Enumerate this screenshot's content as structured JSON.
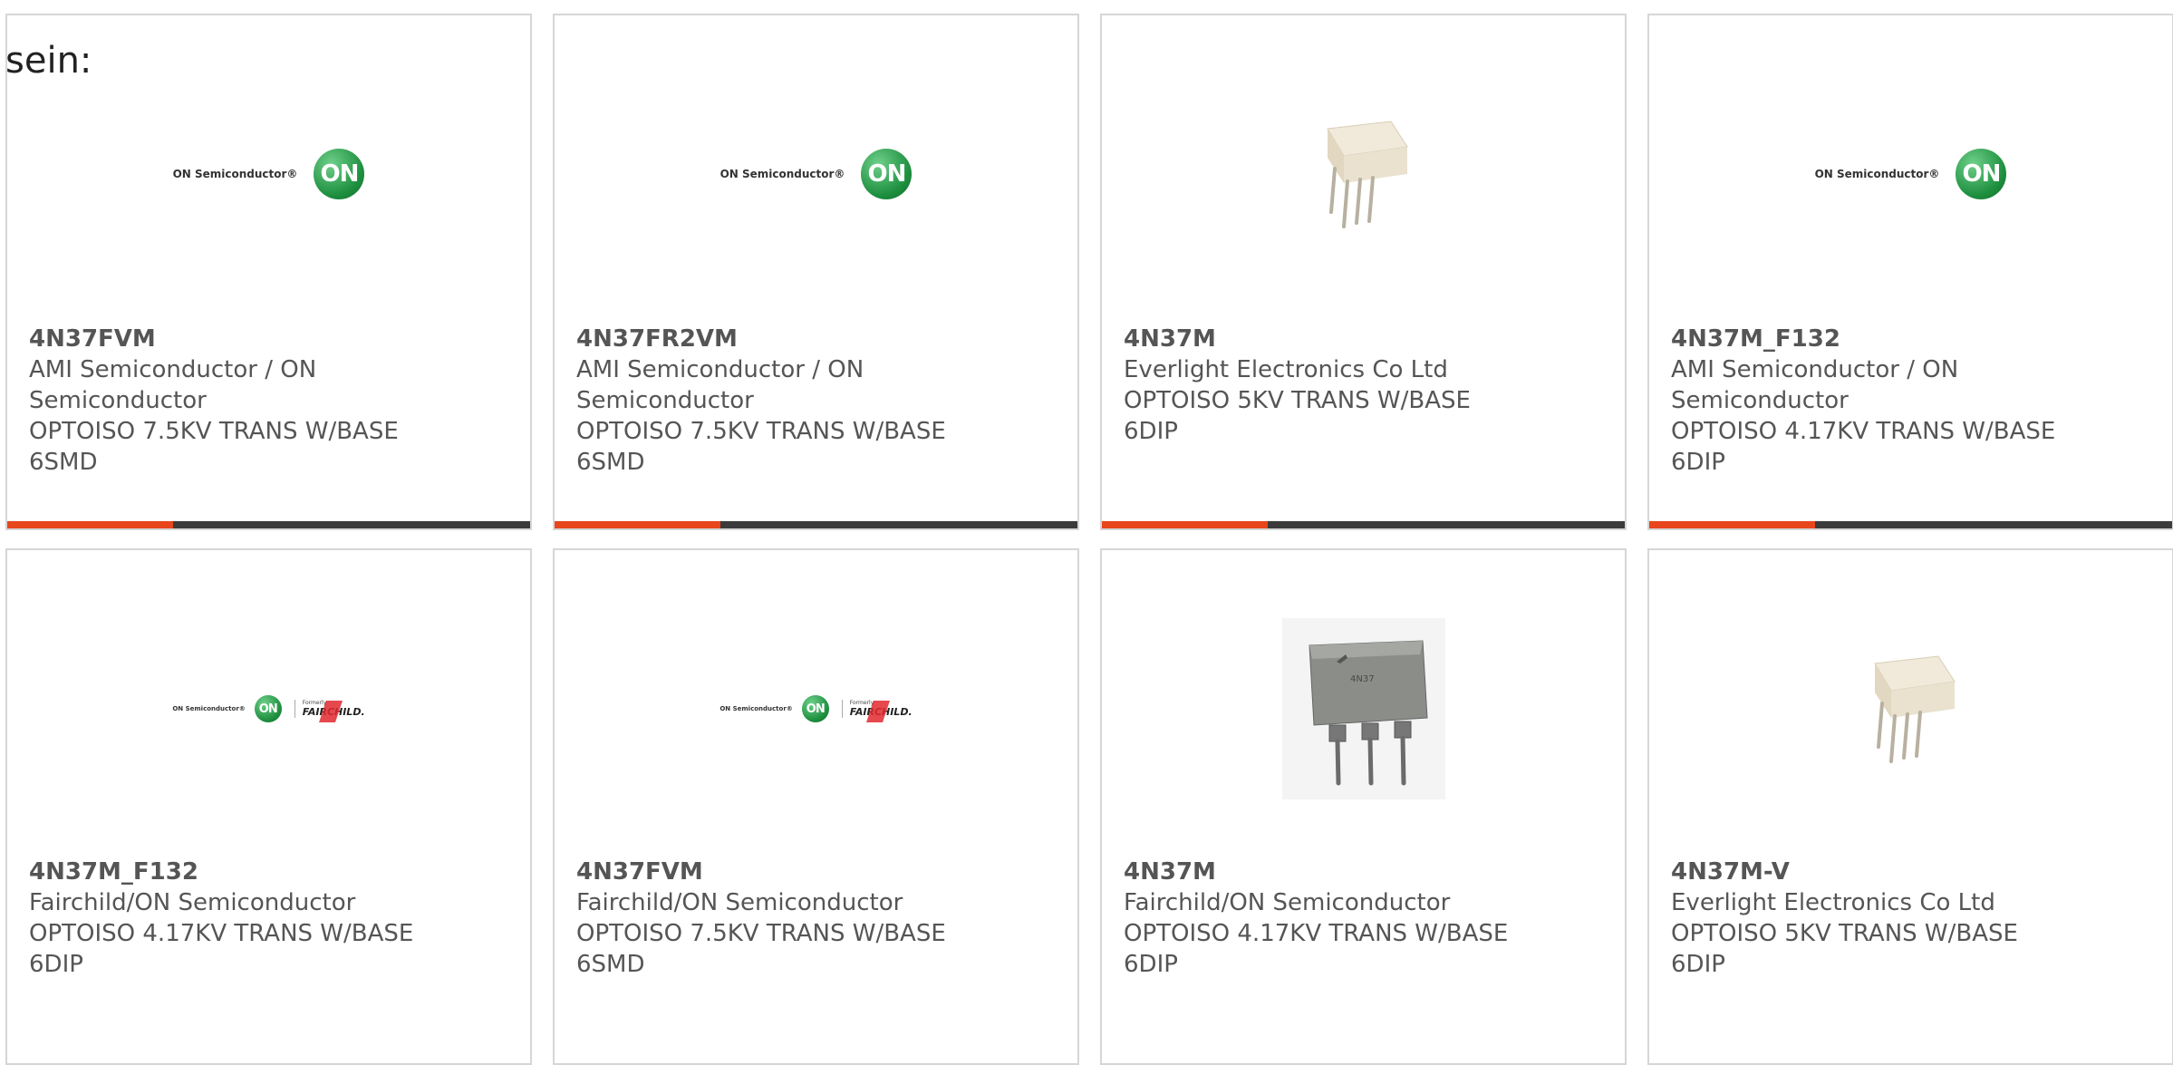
{
  "lead_text": "sein:",
  "brand_colors": {
    "accent": "#e8461c",
    "bar": "#3b3b3b",
    "on_green": "#1e8f3f"
  },
  "logos": {
    "on_text": "ON Semiconductor®",
    "on_circle": "ON",
    "fairchild_formerly": "Formerly",
    "fairchild_name": "FAIRCHILD."
  },
  "chip_marking": "4N37",
  "products": [
    {
      "part": "4N37FVM",
      "lines": [
        "AMI Semiconductor / ON",
        "Semiconductor",
        "OPTOISO 7.5KV TRANS W/BASE",
        "6SMD"
      ],
      "image": "on-logo"
    },
    {
      "part": "4N37FR2VM",
      "lines": [
        "AMI Semiconductor / ON",
        "Semiconductor",
        "OPTOISO 7.5KV TRANS W/BASE",
        "6SMD"
      ],
      "image": "on-logo"
    },
    {
      "part": "4N37M",
      "lines": [
        "Everlight Electronics Co Ltd",
        "OPTOISO 5KV TRANS W/BASE",
        "6DIP"
      ],
      "image": "white-dip-chip"
    },
    {
      "part": "4N37M_F132",
      "lines": [
        "AMI Semiconductor / ON",
        "Semiconductor",
        "OPTOISO 4.17KV TRANS W/BASE",
        "6DIP"
      ],
      "image": "on-logo"
    },
    {
      "part": "4N37M_F132",
      "lines": [
        "Fairchild/ON Semiconductor",
        "OPTOISO 4.17KV TRANS W/BASE",
        "6DIP"
      ],
      "image": "on-fairchild-logo"
    },
    {
      "part": "4N37FVM",
      "lines": [
        "Fairchild/ON Semiconductor",
        "OPTOISO 7.5KV TRANS W/BASE",
        "6SMD"
      ],
      "image": "on-fairchild-logo"
    },
    {
      "part": "4N37M",
      "lines": [
        "Fairchild/ON Semiconductor",
        "OPTOISO 4.17KV TRANS W/BASE",
        "6DIP"
      ],
      "image": "grey-dip-chip"
    },
    {
      "part": "4N37M-V",
      "lines": [
        "Everlight Electronics Co Ltd",
        "OPTOISO 5KV TRANS W/BASE",
        "6DIP"
      ],
      "image": "white-dip-chip"
    }
  ]
}
